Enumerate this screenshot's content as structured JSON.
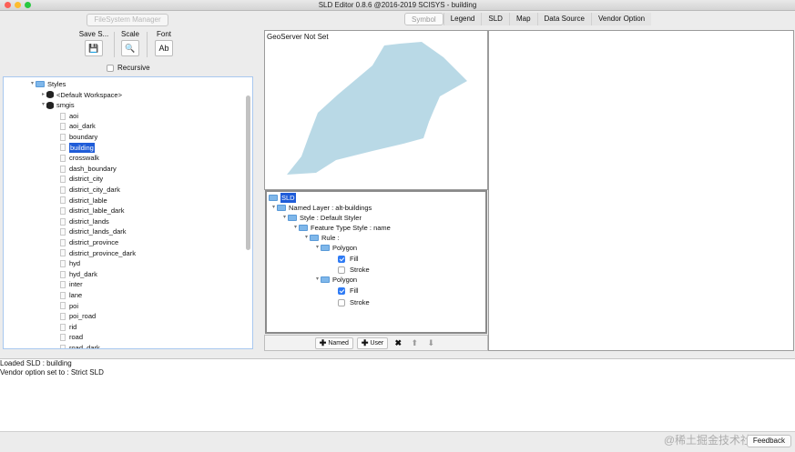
{
  "window": {
    "title": "SLD Editor 0.8.6 @2016-2019 SCISYS - building"
  },
  "left": {
    "filesystem_button": "FileSystem Manager",
    "tools": [
      {
        "label": "Save S...",
        "icon": "floppy-icon",
        "glyph": "💾"
      },
      {
        "label": "Scale",
        "icon": "search-icon",
        "glyph": "🔍"
      },
      {
        "label": "Font",
        "icon": "font-icon",
        "glyph": "Ab"
      }
    ],
    "recursive_label": "Recursive",
    "tree": {
      "root": "Styles",
      "workspaces": [
        "<Default Workspace>",
        "smgis"
      ],
      "items": [
        "aoi",
        "aoi_dark",
        "boundary",
        "building",
        "crosswalk",
        "dash_boundary",
        "district_city",
        "district_city_dark",
        "district_lable",
        "district_lable_dark",
        "district_lands",
        "district_lands_dark",
        "district_province",
        "district_province_dark",
        "hyd",
        "hyd_dark",
        "inter",
        "lane",
        "poi",
        "poi_road",
        "rid",
        "road",
        "road_dark"
      ],
      "selected": "building"
    }
  },
  "tabs": [
    "Symbol",
    "Legend",
    "SLD",
    "Map",
    "Data Source",
    "Vendor Option"
  ],
  "active_tab": "Symbol",
  "preview": {
    "label": "GeoServer Not Set",
    "fill_color": "#b9d9e6"
  },
  "sld_tree": {
    "root": "SLD",
    "named_layer": "Named Layer : alt-buildings",
    "style": "Style : Default Styler",
    "feature_type_style": "Feature Type Style : name",
    "rule": "Rule :",
    "polygon1": "Polygon",
    "fill1": "Fill",
    "stroke1": "Stroke",
    "polygon2": "Polygon",
    "fill2": "Fill",
    "stroke2": "Stroke"
  },
  "sld_toolbar": {
    "named": "Named",
    "user": "User"
  },
  "log": [
    "Loaded SLD : building",
    "Vendor option set to : Strict SLD"
  ],
  "feedback_label": "Feedback",
  "watermark": "@稀土掘金技术社区",
  "colors": {
    "selection": "#1f5cd8",
    "check": "#2f7bf5"
  }
}
